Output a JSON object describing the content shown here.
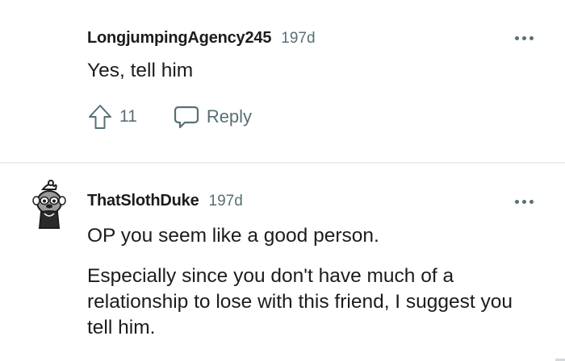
{
  "comments": [
    {
      "username": "LongjumpingAgency245",
      "age": "197d",
      "paragraphs": [
        "Yes, tell him"
      ],
      "score": "11",
      "reply_label": "Reply"
    },
    {
      "username": "ThatSlothDuke",
      "age": "197d",
      "paragraphs": [
        "OP you seem like a good person.",
        "Especially since you don't have much of a relationship to lose with this friend, I suggest you tell him."
      ]
    }
  ],
  "icons": {
    "more": "more-options-icon",
    "upvote": "upvote-arrow-icon",
    "reply": "comment-bubble-icon"
  },
  "colors": {
    "text": "#1c1c1c",
    "muted": "#576f76",
    "divider": "#ebedef"
  }
}
